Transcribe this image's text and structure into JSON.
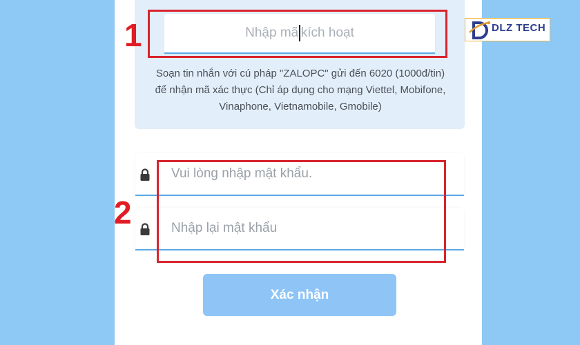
{
  "activation": {
    "placeholder_before": "Nhập mã",
    "placeholder_after": "kích hoạt",
    "sms_instructions": "Soạn tin nhắn với cú pháp \"ZALOPC\" gửi đến 6020 (1000đ/tin) để nhận mã xác thực (Chỉ áp dụng cho mạng Viettel, Mobifone, Vinaphone, Vietnamobile, Gmobile)"
  },
  "password": {
    "placeholder": "Vui lòng nhập mật khẩu.",
    "confirm_placeholder": "Nhập lại mật khẩu"
  },
  "confirm_button": "Xác nhận",
  "annotations": {
    "step1": "1",
    "step2": "2"
  },
  "logo": {
    "text": "DLZ TECH"
  },
  "colors": {
    "background": "#8ec8f4",
    "accent": "#5aa9e6",
    "button": "#8ec5f6",
    "highlight": "#d9232d"
  },
  "icons": [
    "lock-icon"
  ]
}
